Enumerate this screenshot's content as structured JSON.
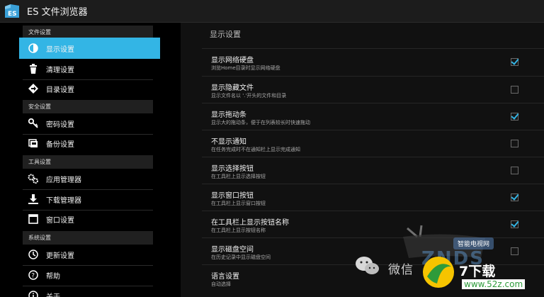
{
  "app": {
    "title": "ES 文件浏览器"
  },
  "sidebar": {
    "sections": [
      {
        "header": "文件设置",
        "items": [
          {
            "label": "显示设置",
            "icon": "contrast-icon",
            "active": true
          },
          {
            "label": "清理设置",
            "icon": "trash-icon"
          },
          {
            "label": "目录设置",
            "icon": "diamond-arrow-icon"
          }
        ]
      },
      {
        "header": "安全设置",
        "items": [
          {
            "label": "密码设置",
            "icon": "key-icon"
          },
          {
            "label": "备份设置",
            "icon": "backup-icon"
          }
        ]
      },
      {
        "header": "工具设置",
        "items": [
          {
            "label": "应用管理器",
            "icon": "gears-icon"
          },
          {
            "label": "下载管理器",
            "icon": "download-icon"
          },
          {
            "label": "窗口设置",
            "icon": "window-icon"
          }
        ]
      },
      {
        "header": "系统设置",
        "items": [
          {
            "label": "更新设置",
            "icon": "clock-icon"
          },
          {
            "label": "帮助",
            "icon": "help-icon"
          },
          {
            "label": "关于",
            "icon": "info-icon"
          }
        ]
      }
    ]
  },
  "content": {
    "title": "显示设置",
    "rows": [
      {
        "label": "显示网络硬盘",
        "desc": "浏览Home目录时显示网络硬盘",
        "checked": true
      },
      {
        "label": "显示隐藏文件",
        "desc": "显示文件名以 '.'开头的文件和目录",
        "checked": false
      },
      {
        "label": "显示拖动条",
        "desc": "显示大的拖动条，便于在列表较长时快速拖动",
        "checked": true
      },
      {
        "label": "不显示通知",
        "desc": "在任务完成时不在通知栏上显示完成通知",
        "checked": false
      },
      {
        "label": "显示选择按钮",
        "desc": "在工具栏上显示选择按钮",
        "checked": false
      },
      {
        "label": "显示窗口按钮",
        "desc": "在工具栏上显示窗口按钮",
        "checked": true
      },
      {
        "label": "在工具栏上显示按钮名称",
        "desc": "在工具栏上显示按钮名称",
        "checked": true
      },
      {
        "label": "显示磁盘空间",
        "desc": "在历史记录中显示磁盘空间",
        "checked": false
      },
      {
        "label": "语言设置",
        "desc": "自动选择",
        "checked": null
      }
    ]
  },
  "watermark": {
    "wechat_text": "微信",
    "tv_badge": "智能电视网",
    "tv_logo": "ZNDS",
    "brand": "7下载",
    "url": "www.52z.com"
  },
  "colors": {
    "accent": "#33b5e5",
    "titlebar": "#1c1c1c",
    "section_header": "#202020"
  }
}
